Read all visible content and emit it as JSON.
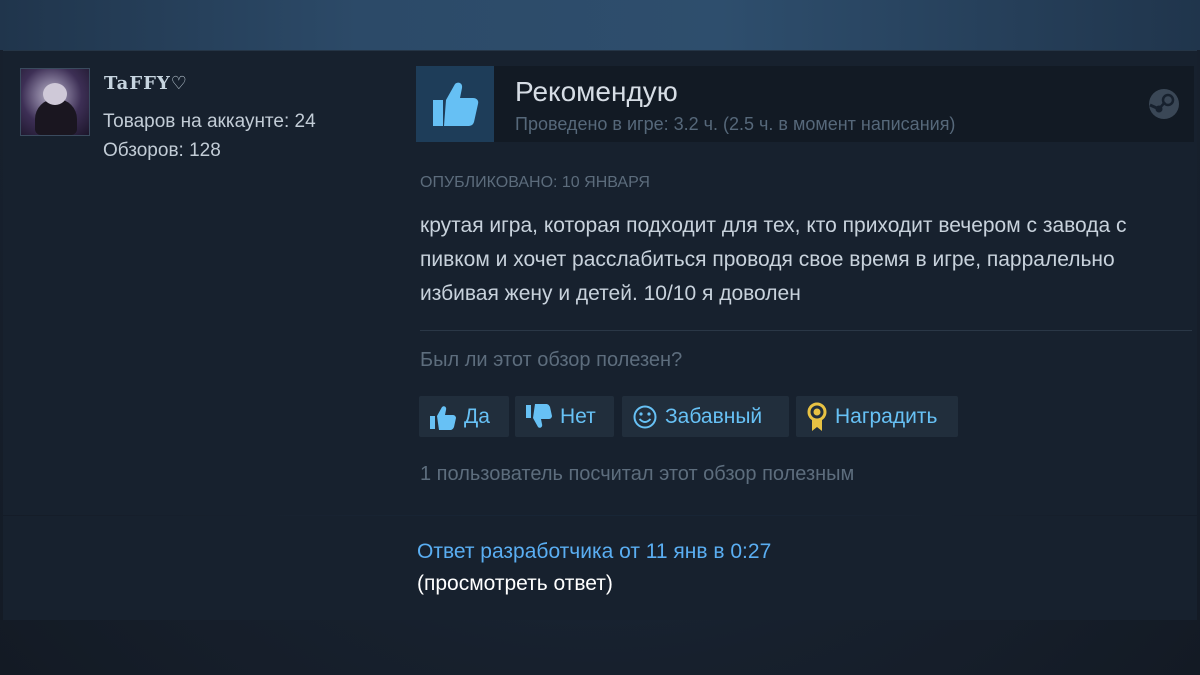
{
  "author": {
    "name": "TaFFY♡",
    "products": "Товаров на аккаунте: 24",
    "reviews": "Обзоров: 128"
  },
  "review": {
    "verdict": "Рекомендую",
    "playtime": "Проведено в игре: 3.2 ч. (2.5 ч. в момент написания)",
    "posted": "Опубликовано: 10 января",
    "text": "крутая игра, которая подходит для тех, кто приходит вечером с завода с пивком и хочет расслабиться проводя свое время в игре, парралельно избивая жену и детей. 10/10 я доволен"
  },
  "helpful": {
    "question": "Был ли этот обзор полезен?",
    "yes": "Да",
    "no": "Нет",
    "funny": "Забавный",
    "award": "Наградить",
    "count": "1 пользователь посчитал этот обзор полезным"
  },
  "developer": {
    "response": "Ответ разработчика от 11 янв в 0:27",
    "view": "(просмотреть ответ)"
  },
  "icons": {
    "verdict": "thumbs-up-icon",
    "platform": "steam-icon",
    "yes": "thumbs-up-icon",
    "no": "thumbs-down-icon",
    "funny": "smiley-icon",
    "award": "award-medal-icon"
  },
  "colors": {
    "accent_link": "#67c1f5",
    "thumb_blue": "#66c0f4",
    "award_gold": "#e8c243"
  }
}
